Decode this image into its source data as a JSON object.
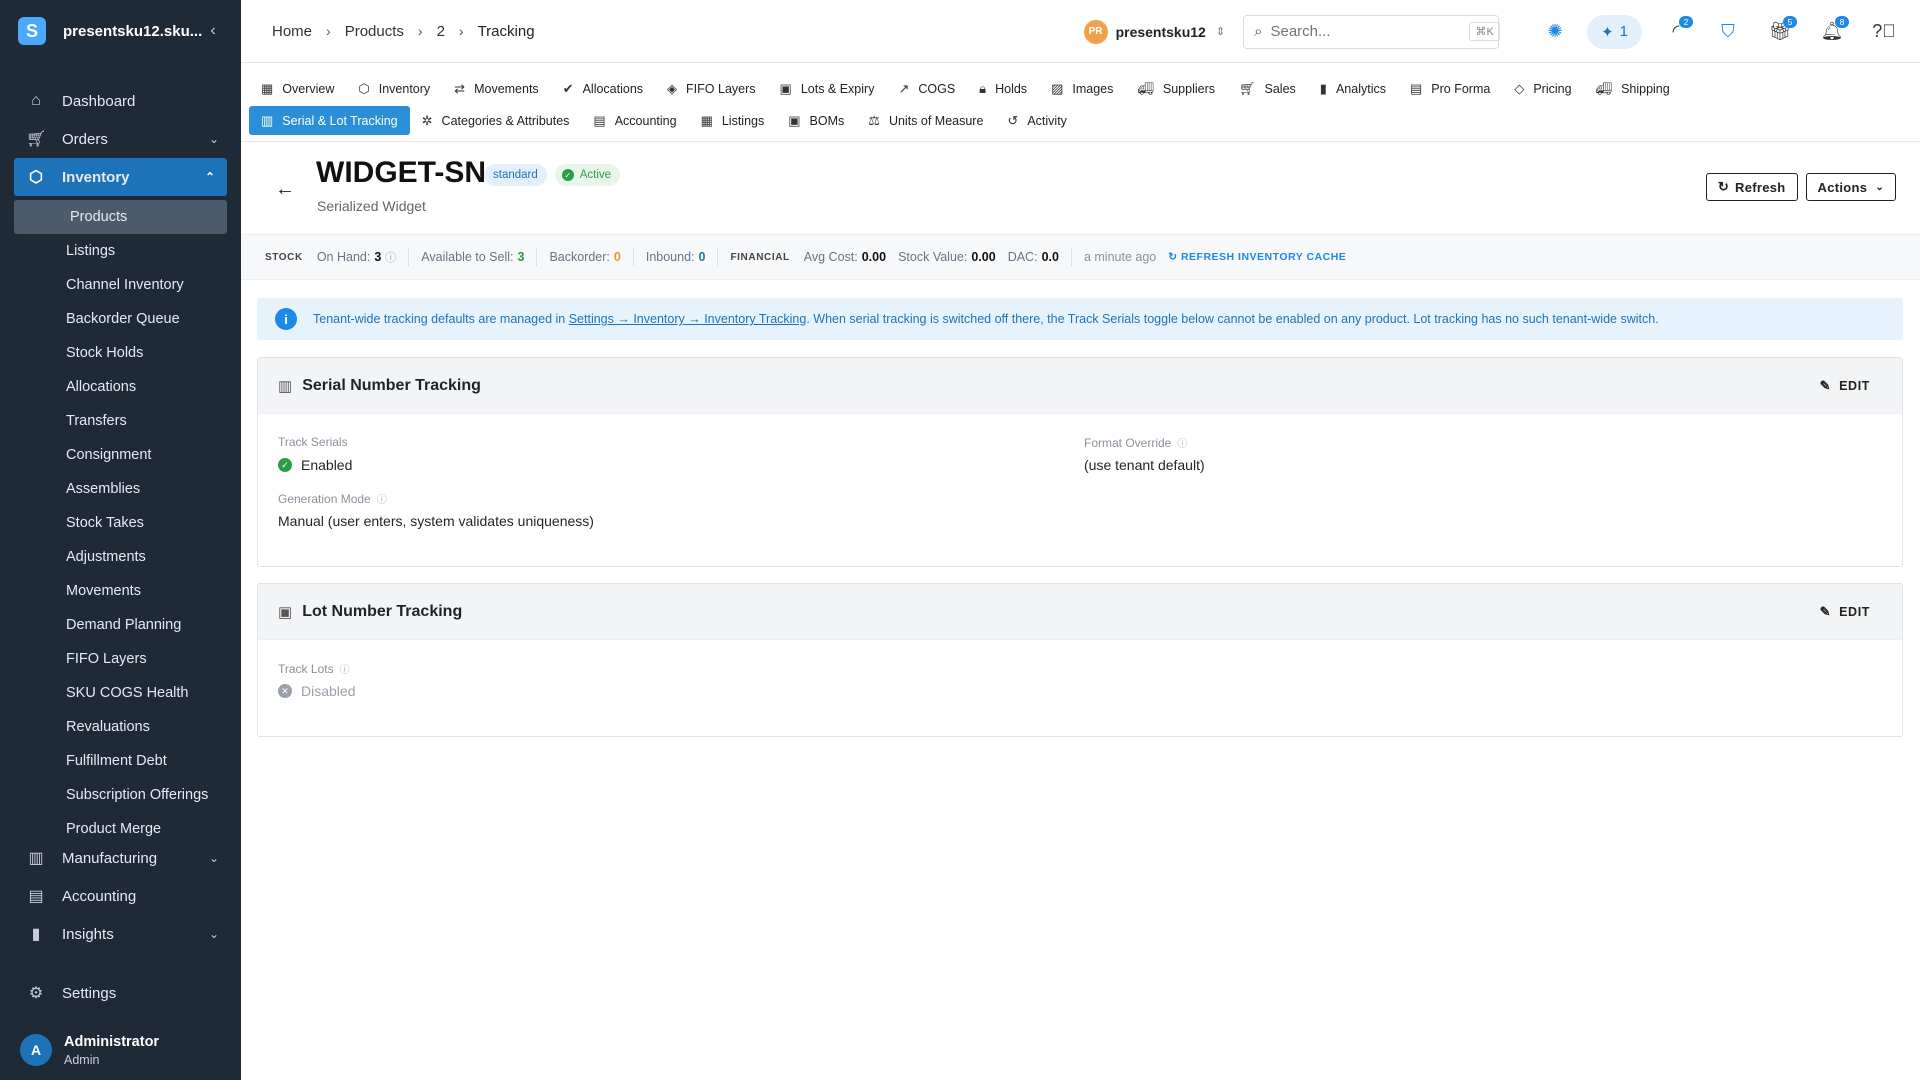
{
  "sidebar": {
    "tenant": "presentsku12.sku...",
    "logo_letter": "S",
    "collapse_icon": "chevron-left-icon",
    "nav": [
      {
        "label": "Dashboard",
        "icon": "home-icon"
      },
      {
        "label": "Orders",
        "icon": "cart-icon"
      },
      {
        "label": "Inventory",
        "icon": "box-icon"
      }
    ],
    "inventory_sub": [
      "Products",
      "Listings",
      "Channel Inventory",
      "Backorder Queue",
      "Stock Holds",
      "Allocations",
      "Transfers",
      "Consignment",
      "Assemblies",
      "Stock Takes",
      "Adjustments",
      "Movements",
      "Demand Planning",
      "FIFO Layers",
      "SKU COGS Health",
      "Revaluations",
      "Fulfillment Debt",
      "Subscription Offerings",
      "Product Merge"
    ],
    "nav_after": [
      {
        "label": "Manufacturing",
        "icon": "factory-icon"
      },
      {
        "label": "Accounting",
        "icon": "ledger-icon"
      },
      {
        "label": "Insights",
        "icon": "bar-chart-icon"
      }
    ],
    "settings_label": "Settings",
    "user": {
      "initial": "A",
      "name": "Administrator",
      "role": "Admin"
    }
  },
  "topbar": {
    "breadcrumbs": [
      "Home",
      "Products",
      "2",
      "Tracking"
    ],
    "tenant_initials": "PR",
    "tenant_name": "presentsku12",
    "search_placeholder": "Search...",
    "search_shortcut": "⌘K",
    "ai_count": "1",
    "badge_activity": "2",
    "badge_gift": "5",
    "badge_bell": "8"
  },
  "tabs": {
    "row1": [
      "Overview",
      "Inventory",
      "Movements",
      "Allocations",
      "FIFO Layers",
      "Lots & Expiry",
      "COGS",
      "Holds",
      "Images",
      "Suppliers",
      "Sales",
      "Analytics",
      "Pro Forma",
      "Pricing",
      "Shipping"
    ],
    "row2": [
      "Serial & Lot Tracking",
      "Categories & Attributes",
      "Accounting",
      "Listings",
      "BOMs",
      "Units of Measure",
      "Activity"
    ]
  },
  "product": {
    "sku": "WIDGET-SN",
    "type_badge": "standard",
    "status_badge": "Active",
    "name": "Serialized Widget",
    "refresh_label": "Refresh",
    "actions_label": "Actions"
  },
  "stock": {
    "stock_label": "STOCK",
    "on_hand_label": "On Hand:",
    "on_hand": "3",
    "available_label": "Available to Sell:",
    "available": "3",
    "backorder_label": "Backorder:",
    "backorder": "0",
    "inbound_label": "Inbound:",
    "inbound": "0",
    "financial_label": "FINANCIAL",
    "avg_cost_label": "Avg Cost:",
    "avg_cost": "0.00",
    "stock_value_label": "Stock Value:",
    "stock_value": "0.00",
    "dac_label": "DAC:",
    "dac": "0.0",
    "updated": "a minute ago",
    "refresh_cache": "REFRESH INVENTORY CACHE"
  },
  "banner": {
    "pre": "Tenant-wide tracking defaults are managed in ",
    "link": "Settings → Inventory → Inventory Tracking",
    "post": ". When serial tracking is switched off there, the Track Serials toggle below cannot be enabled on any product. Lot tracking has no such tenant-wide switch."
  },
  "serial_card": {
    "title": "Serial Number Tracking",
    "edit": "EDIT",
    "track_label": "Track Serials",
    "track_value": "Enabled",
    "format_label": "Format Override",
    "format_value": "(use tenant default)",
    "mode_label": "Generation Mode",
    "mode_value": "Manual (user enters, system validates uniqueness)"
  },
  "lot_card": {
    "title": "Lot Number Tracking",
    "edit": "EDIT",
    "track_label": "Track Lots",
    "track_value": "Disabled"
  }
}
